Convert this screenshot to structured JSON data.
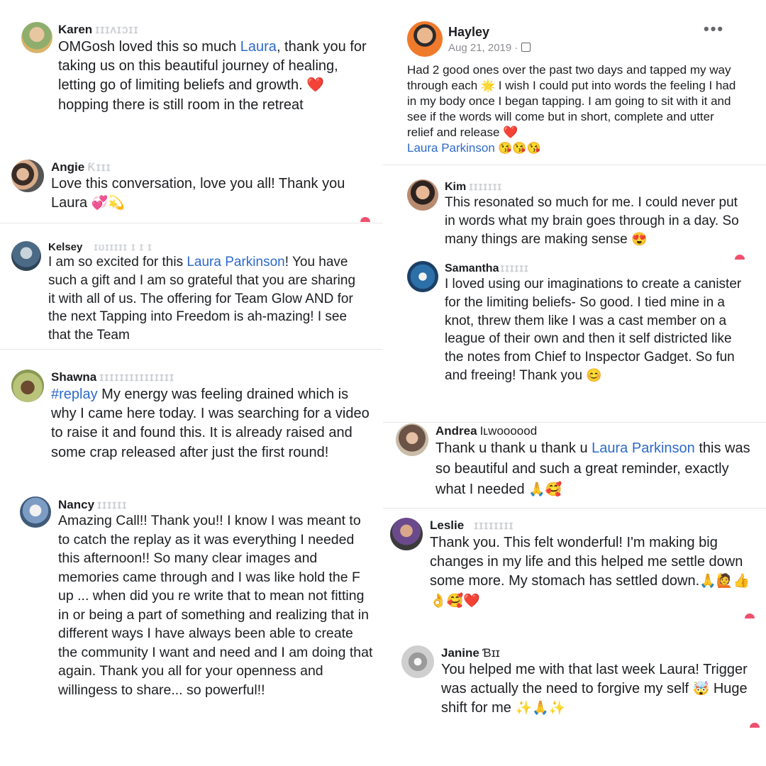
{
  "accent_link": "#2d6ac9",
  "left": [
    {
      "name": "Karen",
      "surname": "ɪɪɪʌɪɔɪɪ",
      "p1": "OMGosh loved this so much ",
      "link": "Laura",
      "p2": ", thank you for taking us on this beautiful journey of healing, letting go of limiting beliefs and growth. ",
      "e1": "❤️",
      "p3": " hopping there is still room in the retreat"
    },
    {
      "name": "Angie",
      "surname": "Ƙɪɪɪ",
      "p1": "Love this conversation, love you all! Thank you Laura ",
      "e1": "💞💫"
    },
    {
      "name": "Kelsey",
      "surname": "ɪʊɪɪɪɪɪ ɪ ɪ ɪ",
      "p1": "I am so excited for this ",
      "link": "Laura Parkinson",
      "p2": "! You have such a gift and I am so grateful that you are sharing it with all of us. The offering for Team Glow AND for the next Tapping into Freedom is ah-mazing! I see that the Team"
    },
    {
      "name": "Shawna",
      "surname": "ɪɪɪɪɪɪɪɪɪɪɪɪɪɪɪ",
      "hash": "#replay",
      "p1": " My energy was feeling drained which is why I came here today. I was searching for a video to raise it and found this. It is already raised and some crap released after just the first round!"
    },
    {
      "name": "Nancy",
      "surname": "ɪɪɪɪɪɪ",
      "p1": "Amazing Call!! Thank you!! I know I was meant to to catch the replay as it was everything I needed this afternoon!! So many clear images and memories came through and I was like hold the F up ... when did you re write that to mean not fitting in or being a part of something and realizing that in different ways I have always been able to create the community I want and need and I am doing that again. Thank you all for your openness and willingess to share... so powerful!!"
    }
  ],
  "post": {
    "name": "Hayley",
    "date": "Aug 21, 2019 ·",
    "privacy_icon": "group-privacy-icon",
    "more_icon": "•••",
    "p1": "Had 2 good ones over the past two days and tapped my way through each ",
    "e1": "🌟",
    "p2": " I wish I could put into words the feeling I had in my body once I began tapping. I am going to sit with it and see if the words will come but in short, complete and utter relief and release ",
    "e2": "❤️",
    "link": "Laura Parkinson",
    "e3": " 😘😘😘"
  },
  "right": [
    {
      "name": "Kim",
      "surname": "ɪɪɪɪɪɪɪ",
      "p1": "This resonated so much for me. I could never put in words what my brain goes through in a day. So many things are making sense ",
      "e1": "😍"
    },
    {
      "name": "Samantha",
      "surname": "ɪɪɪɪɪɪ",
      "p1": "I loved using our imaginations to create a canister for the limiting beliefs- So good. I tied mine in a knot, threw them like I was a cast member on a league of their own and then it self districted like the notes from Chief to Inspector Gadget. So fun and freeing! Thank you ",
      "e1": "😊"
    },
    {
      "name": "Andrea",
      "surname": "Iʟwoooood",
      "p1": "Thank u thank u thank u ",
      "link": "Laura Parkinson",
      "p2": " this was so beautiful and such a great reminder, exactly what I needed ",
      "e1": "🙏🥰"
    },
    {
      "name": "Leslie",
      "surname": "ɪɪɪɪɪɪɪɪ",
      "p1": "Thank you. This felt wonderful! I'm making big changes in my life and this helped me settle down some more. My stomach has settled down.",
      "e1": "🙏🙋👍👌🥰❤️"
    },
    {
      "name": "Janine",
      "surname": "Ɓɪɪ",
      "p1": "You helped me with that last week Laura! Trigger was actually the need to forgive my self ",
      "e1": "🤯",
      "p2": " Huge shift for me ",
      "e2": "✨🙏✨"
    }
  ]
}
